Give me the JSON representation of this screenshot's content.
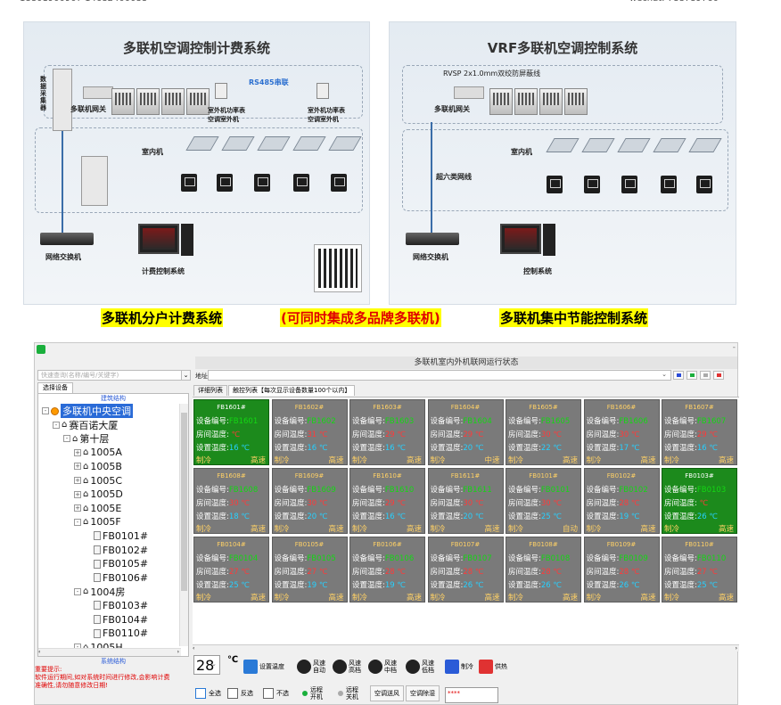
{
  "diagram_left": {
    "title": "多联机空调控制计费系统",
    "labels": [
      "数据采集器",
      "多联机网关",
      "RS485串联",
      "室外机功率表",
      "空调室外机",
      "室外机功率表",
      "空调室外机",
      "室内机",
      "网络交换机",
      "计费控制系统"
    ]
  },
  "diagram_right": {
    "title": "VRF多联机空调控制系统",
    "labels": [
      "RVSP 2x1.0mm双绞防屏蔽线",
      "多联机网关",
      "室内机",
      "超六类网线",
      "网络交换机",
      "控制系统"
    ]
  },
  "captions": {
    "left": "多联机分户计费系统",
    "middle": "(可同时集成多品牌多联机)",
    "right": "多联机集中节能控制系统"
  },
  "colors": {
    "caption_highlight": "#ffff00",
    "card_off": "#7a7a7a",
    "card_on": "#1c8a1c",
    "room_temp": "#ff3a3a",
    "set_temp": "#27d0ff",
    "device_id": "#14d714"
  },
  "app": {
    "title": "多联机室内外机联网运行状态",
    "search_placeholder": "快速查询(名称/编号/关键字)",
    "left_tab": "选择设备",
    "tree_header": "建筑结构",
    "tree_footer": "系统结构",
    "address_label": "地址(D)",
    "tabs": [
      "详细列表",
      "触控列表【每次显示设备数量100个以内】"
    ],
    "tree": [
      {
        "label": "多联机中央空调",
        "depth": 0,
        "icon": "root",
        "expand": "-",
        "selected": true
      },
      {
        "label": "赛百诺大厦",
        "depth": 1,
        "icon": "home",
        "expand": "-"
      },
      {
        "label": "第十层",
        "depth": 2,
        "icon": "home",
        "expand": "-"
      },
      {
        "label": "1005A",
        "depth": 3,
        "icon": "home",
        "expand": "+"
      },
      {
        "label": "1005B",
        "depth": 3,
        "icon": "home",
        "expand": "+"
      },
      {
        "label": "1005C",
        "depth": 3,
        "icon": "home",
        "expand": "+"
      },
      {
        "label": "1005D",
        "depth": 3,
        "icon": "home",
        "expand": "+"
      },
      {
        "label": "1005E",
        "depth": 3,
        "icon": "home",
        "expand": "+"
      },
      {
        "label": "1005F",
        "depth": 3,
        "icon": "home",
        "expand": "-"
      },
      {
        "label": "FB0101#",
        "depth": 4,
        "icon": "file",
        "expand": ""
      },
      {
        "label": "FB0102#",
        "depth": 4,
        "icon": "file",
        "expand": ""
      },
      {
        "label": "FB0105#",
        "depth": 4,
        "icon": "file",
        "expand": ""
      },
      {
        "label": "FB0106#",
        "depth": 4,
        "icon": "file",
        "expand": ""
      },
      {
        "label": "1004房",
        "depth": 3,
        "icon": "home",
        "expand": "-"
      },
      {
        "label": "FB0103#",
        "depth": 4,
        "icon": "file",
        "expand": ""
      },
      {
        "label": "FB0104#",
        "depth": 4,
        "icon": "file",
        "expand": ""
      },
      {
        "label": "FB0110#",
        "depth": 4,
        "icon": "file",
        "expand": ""
      },
      {
        "label": "1005H",
        "depth": 3,
        "icon": "home",
        "expand": "-"
      }
    ],
    "card_labels": {
      "id": "设备编号:",
      "room": "房间温度:",
      "set": "设置温度:",
      "unit": "℃"
    },
    "cards": [
      {
        "id": "FB1601#",
        "code": "FB1601",
        "room": "",
        "set": "16",
        "mode": "制冷",
        "speed": "高速",
        "on": true
      },
      {
        "id": "FB1602#",
        "code": "FB1602",
        "room": "31",
        "set": "16",
        "mode": "制冷",
        "speed": "高速",
        "on": false
      },
      {
        "id": "FB1603#",
        "code": "FB1603",
        "room": "29",
        "set": "16",
        "mode": "制冷",
        "speed": "高速",
        "on": false
      },
      {
        "id": "FB1604#",
        "code": "FB1604",
        "room": "29",
        "set": "20",
        "mode": "制冷",
        "speed": "中速",
        "on": false
      },
      {
        "id": "FB1605#",
        "code": "FB1605",
        "room": "30",
        "set": "22",
        "mode": "制冷",
        "speed": "高速",
        "on": false
      },
      {
        "id": "FB1606#",
        "code": "FB1606",
        "room": "30",
        "set": "17",
        "mode": "制冷",
        "speed": "高速",
        "on": false
      },
      {
        "id": "FB1607#",
        "code": "FB1607",
        "room": "29",
        "set": "16",
        "mode": "制冷",
        "speed": "高速",
        "on": false
      },
      {
        "id": "FB1608#",
        "code": "FB1608",
        "room": "30",
        "set": "18",
        "mode": "制冷",
        "speed": "高速",
        "on": false
      },
      {
        "id": "FB1609#",
        "code": "FB1609",
        "room": "30",
        "set": "20",
        "mode": "制冷",
        "speed": "高速",
        "on": false
      },
      {
        "id": "FB1610#",
        "code": "FB1610",
        "room": "29",
        "set": "16",
        "mode": "制冷",
        "speed": "高速",
        "on": false
      },
      {
        "id": "FB1611#",
        "code": "FB1611",
        "room": "30",
        "set": "20",
        "mode": "制冷",
        "speed": "高速",
        "on": false
      },
      {
        "id": "FB0101#",
        "code": "FB0101",
        "room": "30",
        "set": "25",
        "mode": "制冷",
        "speed": "自动",
        "on": false
      },
      {
        "id": "FB0102#",
        "code": "FB0102",
        "room": "28",
        "set": "19",
        "mode": "制冷",
        "speed": "高速",
        "on": false
      },
      {
        "id": "FB0103#",
        "code": "FB0103",
        "room": "",
        "set": "26",
        "mode": "制冷",
        "speed": "高速",
        "on": true
      },
      {
        "id": "FB0104#",
        "code": "FB0104",
        "room": "27",
        "set": "25",
        "mode": "制冷",
        "speed": "高速",
        "on": false
      },
      {
        "id": "FB0105#",
        "code": "FB0105",
        "room": "27",
        "set": "19",
        "mode": "制冷",
        "speed": "高速",
        "on": false
      },
      {
        "id": "FB0106#",
        "code": "FB0106",
        "room": "28",
        "set": "19",
        "mode": "制冷",
        "speed": "高速",
        "on": false
      },
      {
        "id": "FB0107#",
        "code": "FB0107",
        "room": "28",
        "set": "26",
        "mode": "制冷",
        "speed": "高速",
        "on": false
      },
      {
        "id": "FB0108#",
        "code": "FB0108",
        "room": "28",
        "set": "26",
        "mode": "制冷",
        "speed": "高速",
        "on": false
      },
      {
        "id": "FB0109#",
        "code": "FB0109",
        "room": "28",
        "set": "26",
        "mode": "制冷",
        "speed": "高速",
        "on": false
      },
      {
        "id": "FB0110#",
        "code": "FB0110",
        "room": "27",
        "set": "25",
        "mode": "制冷",
        "speed": "高速",
        "on": false
      }
    ],
    "controls": {
      "temp_value": "28",
      "temp_unit": "℃",
      "set_temp": "设置温度",
      "fan_auto": [
        "风速",
        "自动"
      ],
      "fan_high": [
        "风速",
        "高档"
      ],
      "fan_mid": [
        "风速",
        "中档"
      ],
      "fan_low": [
        "风速",
        "低档"
      ],
      "cool": "制冷",
      "heat": "供热"
    },
    "bottom": {
      "select_all": "全选",
      "invert": "反选",
      "select_none": "不选",
      "remote_on": [
        "远程",
        "开机"
      ],
      "remote_off": [
        "远程",
        "关机"
      ],
      "fan_mode": "空调送风",
      "dehumidify": "空调除湿",
      "status": "****"
    },
    "notice": [
      "重要提示:",
      "软件运行期间,如对系统时间进行修改,会影响计费",
      "准确性,请勿随意修改日期!"
    ]
  }
}
